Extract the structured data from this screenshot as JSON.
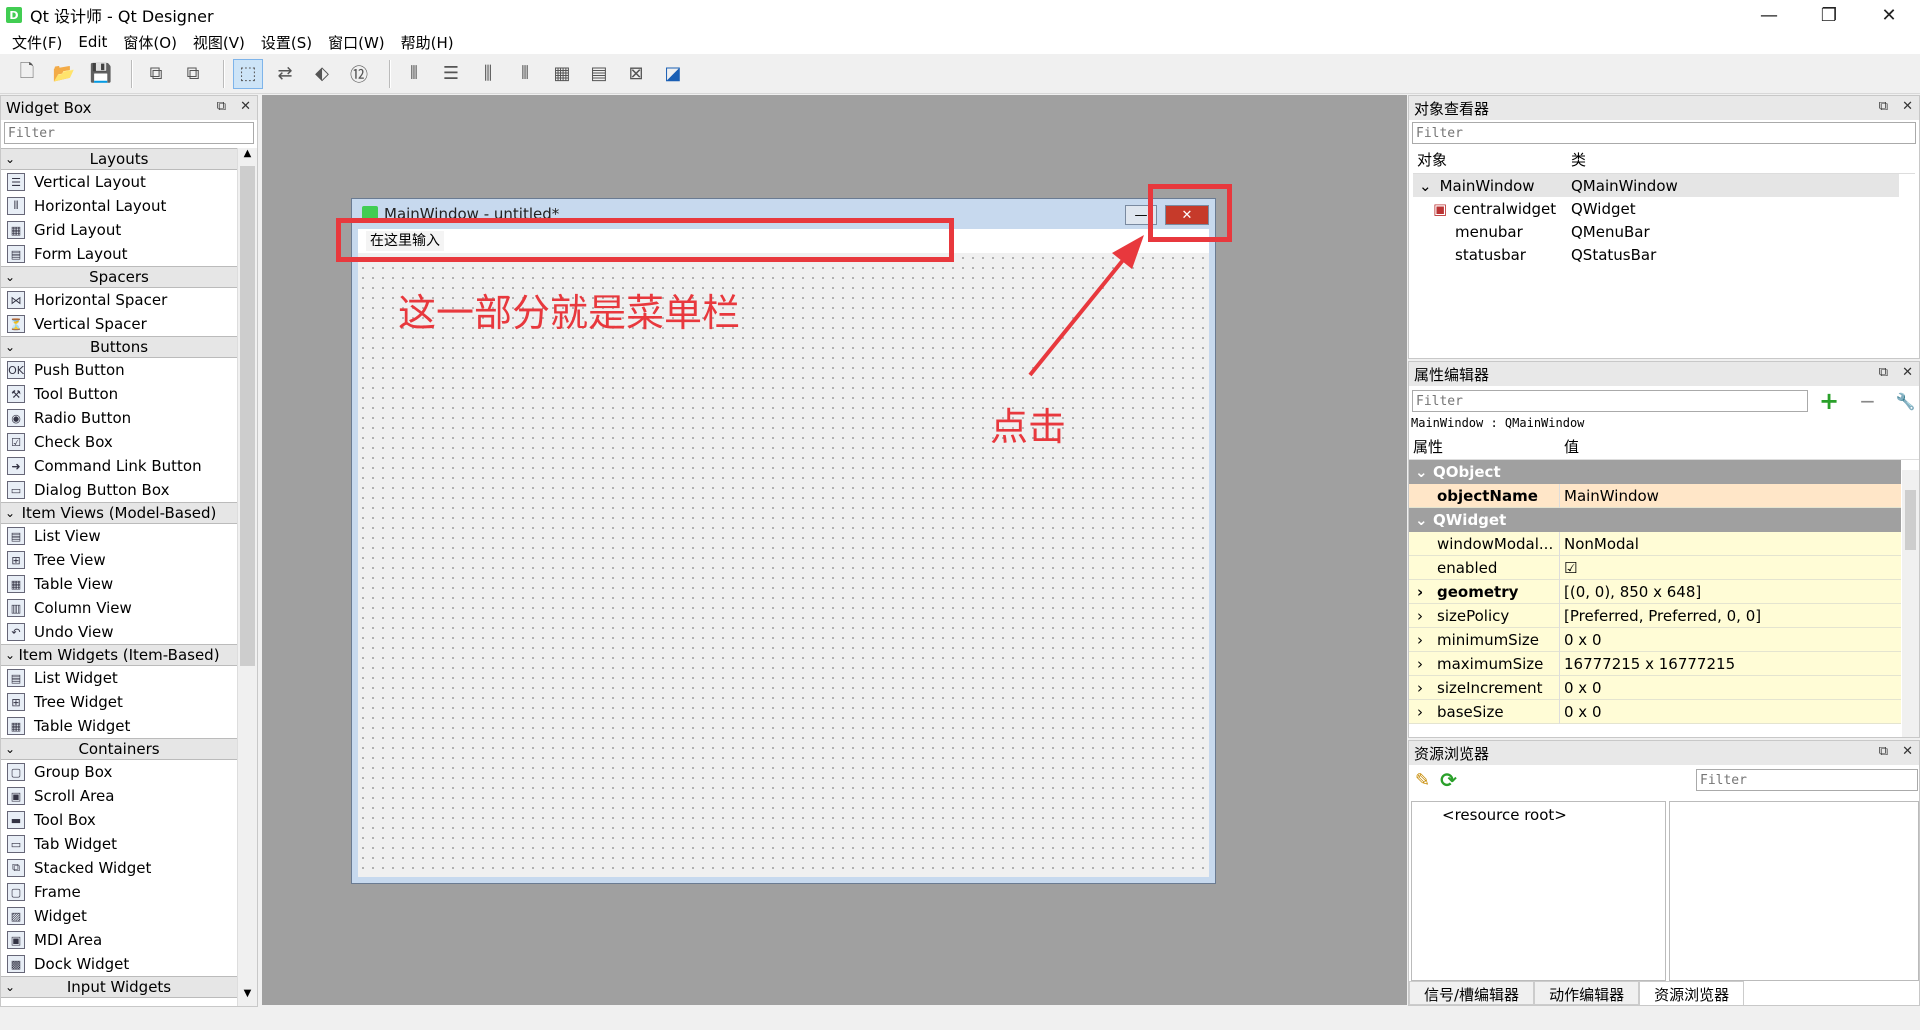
{
  "window": {
    "title": "Qt 设计师 - Qt Designer",
    "app_icon_letter": "D",
    "minimize": "—",
    "restore": "❐",
    "close": "✕"
  },
  "menubar": {
    "items": [
      "文件(F)",
      "Edit",
      "窗体(O)",
      "视图(V)",
      "设置(S)",
      "窗口(W)",
      "帮助(H)"
    ]
  },
  "widget_box": {
    "title": "Widget Box",
    "filter_placeholder": "Filter",
    "categories": [
      {
        "name": "Layouts",
        "items": [
          "Vertical Layout",
          "Horizontal Layout",
          "Grid Layout",
          "Form Layout"
        ]
      },
      {
        "name": "Spacers",
        "items": [
          "Horizontal Spacer",
          "Vertical Spacer"
        ]
      },
      {
        "name": "Buttons",
        "items": [
          "Push Button",
          "Tool Button",
          "Radio Button",
          "Check Box",
          "Command Link Button",
          "Dialog Button Box"
        ]
      },
      {
        "name": "Item Views (Model-Based)",
        "items": [
          "List View",
          "Tree View",
          "Table View",
          "Column View",
          "Undo View"
        ]
      },
      {
        "name": "Item Widgets (Item-Based)",
        "items": [
          "List Widget",
          "Tree Widget",
          "Table Widget"
        ]
      },
      {
        "name": "Containers",
        "items": [
          "Group Box",
          "Scroll Area",
          "Tool Box",
          "Tab Widget",
          "Stacked Widget",
          "Frame",
          "Widget",
          "MDI Area",
          "Dock Widget"
        ]
      },
      {
        "name": "Input Widgets",
        "items": []
      }
    ]
  },
  "form": {
    "title": "MainWindow - untitled*",
    "menu_placeholder": "在这里输入",
    "minimize": "—",
    "close": "✕"
  },
  "annotations": {
    "menubar_note": "这一部分就是菜单栏",
    "click_note": "点击",
    "color": "#e8383d"
  },
  "object_inspector": {
    "title": "对象查看器",
    "filter_placeholder": "Filter",
    "col_object": "对象",
    "col_class": "类",
    "rows": [
      {
        "object": "MainWindow",
        "class": "QMainWindow",
        "level": 0
      },
      {
        "object": "centralwidget",
        "class": "QWidget",
        "level": 1
      },
      {
        "object": "menubar",
        "class": "QMenuBar",
        "level": 1
      },
      {
        "object": "statusbar",
        "class": "QStatusBar",
        "level": 1
      }
    ]
  },
  "property_editor": {
    "title": "属性编辑器",
    "filter_placeholder": "Filter",
    "context": "MainWindow : QMainWindow",
    "col_property": "属性",
    "col_value": "值",
    "group_qobject": "QObject",
    "group_qwidget": "QWidget",
    "object_name": {
      "name": "objectName",
      "value": "MainWindow"
    },
    "props": [
      {
        "name": "windowModal...",
        "value": "NonModal",
        "bold": false,
        "expand": false
      },
      {
        "name": "enabled",
        "value": "☑",
        "bold": false,
        "expand": false
      },
      {
        "name": "geometry",
        "value": "[(0, 0), 850 x 648]",
        "bold": true,
        "expand": true
      },
      {
        "name": "sizePolicy",
        "value": "[Preferred, Preferred, 0, 0]",
        "bold": false,
        "expand": true
      },
      {
        "name": "minimumSize",
        "value": "0 x 0",
        "bold": false,
        "expand": true
      },
      {
        "name": "maximumSize",
        "value": "16777215 x 16777215",
        "bold": false,
        "expand": true
      },
      {
        "name": "sizeIncrement",
        "value": "0 x 0",
        "bold": false,
        "expand": true
      },
      {
        "name": "baseSize",
        "value": "0 x 0",
        "bold": false,
        "expand": true
      }
    ]
  },
  "resource_browser": {
    "title": "资源浏览器",
    "filter_placeholder": "Filter",
    "root": "<resource root>",
    "tabs": [
      "信号/槽编辑器",
      "动作编辑器",
      "资源浏览器"
    ]
  }
}
